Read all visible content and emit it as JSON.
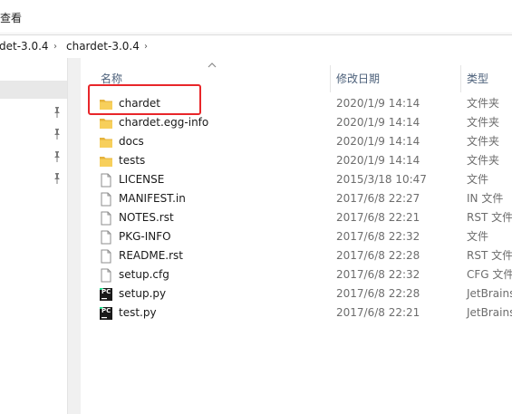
{
  "ribbon": {
    "view_tab": "查看"
  },
  "address": {
    "crumbs": [
      "det-3.0.4",
      "chardet-3.0.4"
    ],
    "separator": "›"
  },
  "columns": {
    "name": "名称",
    "date": "修改日期",
    "type": "类型",
    "sort_arrow": "^"
  },
  "files": [
    {
      "name": "chardet",
      "date": "2020/1/9 14:14",
      "type": "文件夹",
      "icon": "folder-icon"
    },
    {
      "name": "chardet.egg-info",
      "date": "2020/1/9 14:14",
      "type": "文件夹",
      "icon": "folder-icon"
    },
    {
      "name": "docs",
      "date": "2020/1/9 14:14",
      "type": "文件夹",
      "icon": "folder-icon"
    },
    {
      "name": "tests",
      "date": "2020/1/9 14:14",
      "type": "文件夹",
      "icon": "folder-icon"
    },
    {
      "name": "LICENSE",
      "date": "2015/3/18 10:47",
      "type": "文件",
      "icon": "file-icon"
    },
    {
      "name": "MANIFEST.in",
      "date": "2017/6/8 22:27",
      "type": "IN 文件",
      "icon": "file-icon"
    },
    {
      "name": "NOTES.rst",
      "date": "2017/6/8 22:21",
      "type": "RST 文件",
      "icon": "file-icon"
    },
    {
      "name": "PKG-INFO",
      "date": "2017/6/8 22:32",
      "type": "文件",
      "icon": "file-icon"
    },
    {
      "name": "README.rst",
      "date": "2017/6/8 22:28",
      "type": "RST 文件",
      "icon": "file-icon"
    },
    {
      "name": "setup.cfg",
      "date": "2017/6/8 22:32",
      "type": "CFG 文件",
      "icon": "file-icon"
    },
    {
      "name": "setup.py",
      "date": "2017/6/8 22:28",
      "type": "JetBrains",
      "icon": "pycharm-file-icon",
      "badge": "PC"
    },
    {
      "name": "test.py",
      "date": "2017/6/8 22:21",
      "type": "JetBrains",
      "icon": "pycharm-file-icon",
      "badge": "PC"
    }
  ],
  "colors": {
    "folder": "#f7cf5b",
    "folder_dark": "#e6b33d",
    "highlight": "#e8262a",
    "header_text": "#4c607a",
    "pycharm_bg": "#1a1a1a",
    "pycharm_accent": "#21d789"
  }
}
